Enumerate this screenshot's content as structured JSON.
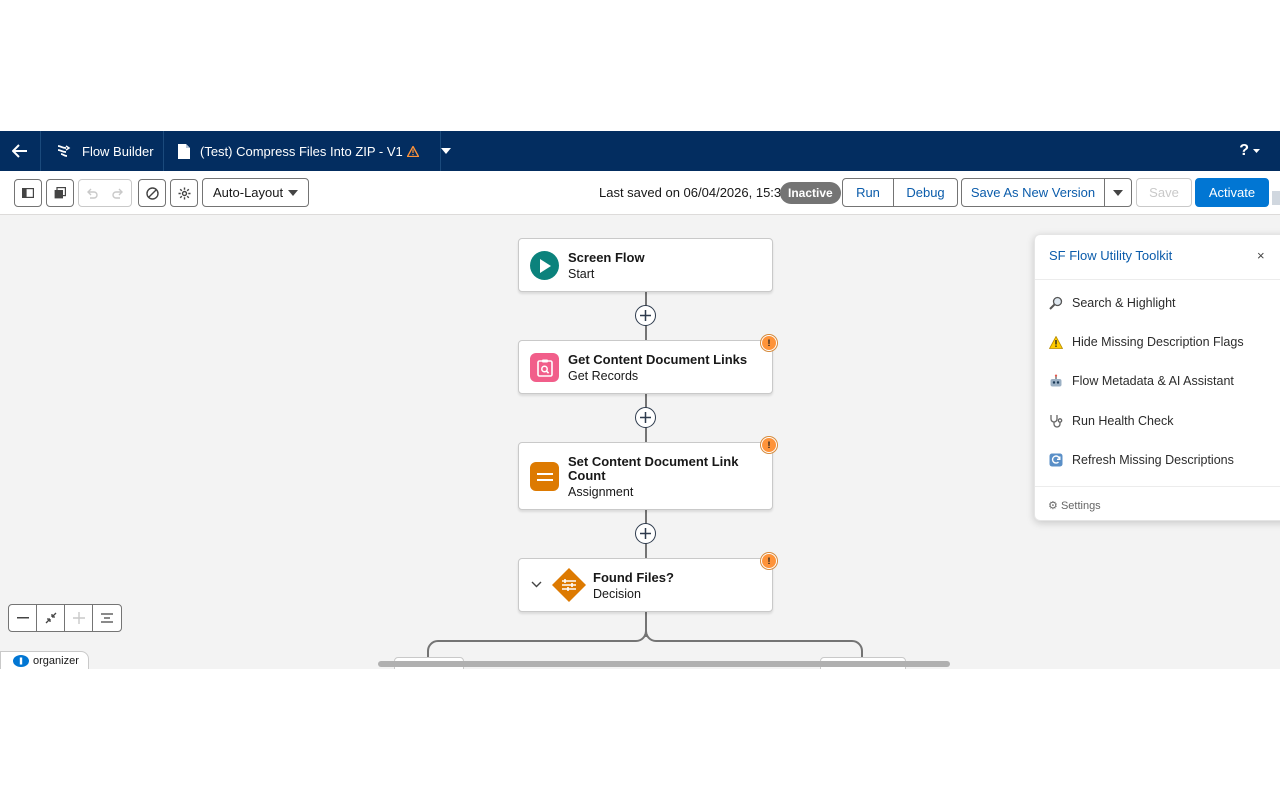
{
  "header": {
    "app_name": "Flow Builder",
    "flow_title": "(Test) Compress Files Into ZIP - V1",
    "help_label": "?"
  },
  "toolbar": {
    "layout_mode": "Auto-Layout",
    "last_saved": "Last saved on 06/04/2026, 15:31",
    "status": "Inactive",
    "run_label": "Run",
    "debug_label": "Debug",
    "save_as_new_label": "Save As New Version",
    "save_label": "Save",
    "activate_label": "Activate"
  },
  "nodes": [
    {
      "title": "Screen Flow",
      "subtitle": "Start",
      "icon": "play-icon",
      "color": "#0b827c"
    },
    {
      "title": "Get Content Document Links",
      "subtitle": "Get Records",
      "icon": "get-records-icon",
      "color": "#f15e8a",
      "warning": true
    },
    {
      "title": "Set Content Document Link Count",
      "subtitle": "Assignment",
      "icon": "assignment-icon",
      "color": "#dd7a01",
      "warning": true
    },
    {
      "title": "Found Files?",
      "subtitle": "Decision",
      "icon": "decision-icon",
      "color": "#dd7a01",
      "warning": true
    }
  ],
  "toolkit": {
    "title": "SF Flow Utility Toolkit",
    "close_label": "×",
    "items": [
      {
        "label": "Search & Highlight",
        "icon": "magnifier-icon"
      },
      {
        "label": "Hide Missing Description Flags",
        "icon": "warning-icon"
      },
      {
        "label": "Flow Metadata & AI Assistant",
        "icon": "robot-icon"
      },
      {
        "label": "Run Health Check",
        "icon": "stethoscope-icon"
      },
      {
        "label": "Refresh Missing Descriptions",
        "icon": "refresh-icon"
      }
    ],
    "settings_label": "Settings"
  },
  "organizer": {
    "label": "organizer"
  },
  "colors": {
    "header_bg": "#032d60",
    "primary": "#0176d3",
    "warning": "#fe9339"
  }
}
